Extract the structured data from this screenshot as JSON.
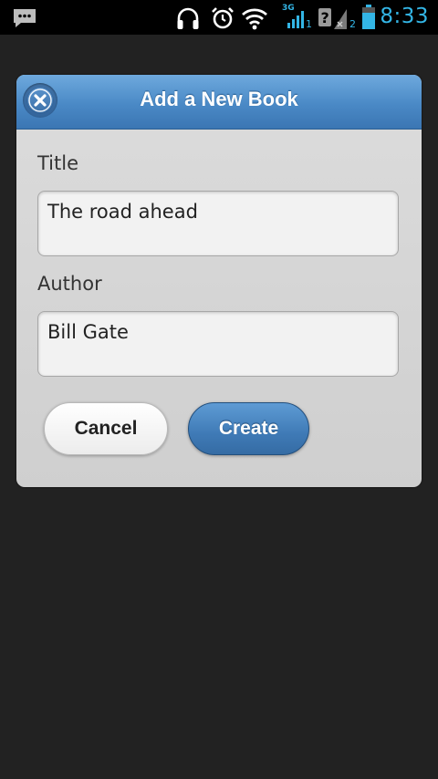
{
  "status_bar": {
    "time": "8:33",
    "network_type": "3G",
    "sim1_label": "1",
    "sim2_label": "2",
    "icons": [
      "message-icon",
      "headphones-icon",
      "alarm-icon",
      "wifi-icon",
      "signal-icon",
      "no-sim-icon",
      "battery-icon"
    ],
    "accent_color": "#33b5e5"
  },
  "dialog": {
    "title": "Add a New Book",
    "close_icon": "close-icon",
    "fields": [
      {
        "label": "Title",
        "value": "The road ahead"
      },
      {
        "label": "Author",
        "value": "Bill Gate"
      }
    ],
    "cancel_label": "Cancel",
    "create_label": "Create",
    "header_color": "#4a89c6"
  }
}
